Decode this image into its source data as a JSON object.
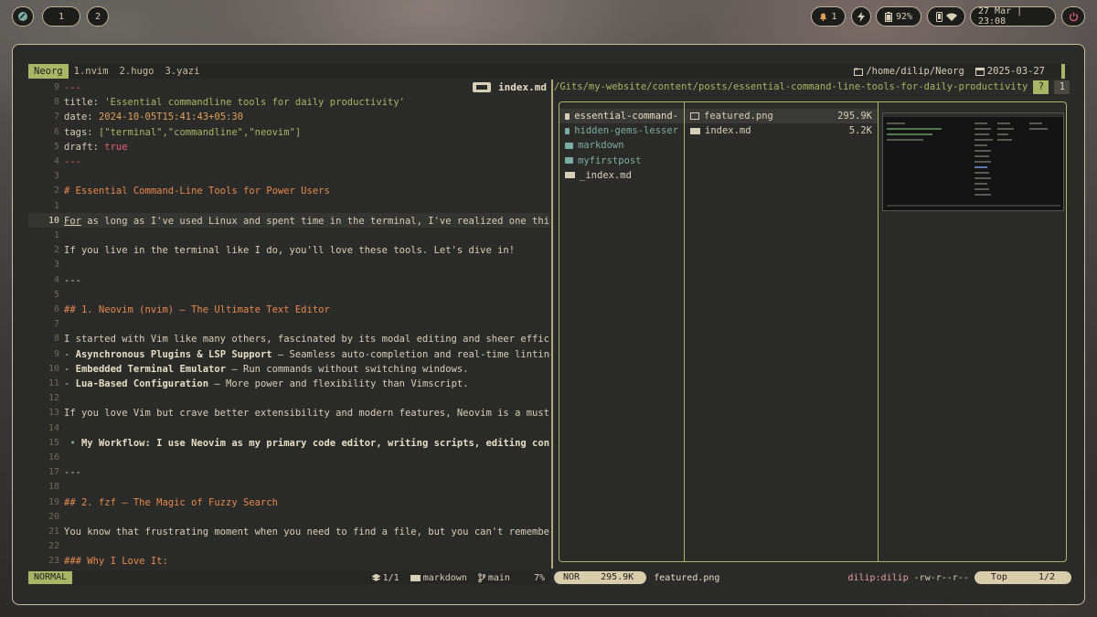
{
  "topbar": {
    "workspaces": [
      "1",
      "2"
    ],
    "notifications": "1",
    "battery": "92%",
    "datetime": "27 Mar | 23:08"
  },
  "tabline": {
    "tabs": [
      "Neorg",
      "1.nvim",
      "2.hugo",
      "3.yazi"
    ],
    "cwd": "/home/dilip/Neorg",
    "date": "2025-03-27"
  },
  "editor": {
    "filename": "index.md",
    "lines": [
      {
        "num": "9",
        "text": "---"
      },
      {
        "num": "8",
        "key": "title",
        "val": "'Essential commandline tools for daily productivity'"
      },
      {
        "num": "7",
        "key": "date",
        "val": "2024-10-05T15:41:43+05:30"
      },
      {
        "num": "6",
        "key": "tags",
        "val": "[\"terminal\",\"commandline\",\"neovim\"]"
      },
      {
        "num": "5",
        "key": "draft",
        "val": "true"
      },
      {
        "num": "4",
        "text": "---"
      },
      {
        "num": "3",
        "text": ""
      },
      {
        "num": "2",
        "text": "# Essential Command-Line Tools for Power Users"
      },
      {
        "num": "1",
        "text": ""
      },
      {
        "num": "10",
        "text": "For as long as I've used Linux and spent time in the terminal, I've realized one thin"
      },
      {
        "num": "1",
        "text": ""
      },
      {
        "num": "2",
        "text": "If you live in the terminal like I do, you'll love these tools. Let's dive in!"
      },
      {
        "num": "3",
        "text": ""
      },
      {
        "num": "4",
        "text": "---"
      },
      {
        "num": "5",
        "text": ""
      },
      {
        "num": "6",
        "text": "## 1. Neovim (nvim) – The Ultimate Text Editor"
      },
      {
        "num": "7",
        "text": ""
      },
      {
        "num": "8",
        "text": "I started with Vim like many others, fascinated by its modal editing and sheer effici"
      },
      {
        "num": "9",
        "bold": "Asynchronous Plugins & LSP Support",
        "rest": " – Seamless auto-completion and real-time linting"
      },
      {
        "num": "10",
        "bold": "Embedded Terminal Emulator",
        "rest": " – Run commands without switching windows."
      },
      {
        "num": "11",
        "bold": "Lua-Based Configuration",
        "rest": " – More power and flexibility than Vimscript."
      },
      {
        "num": "12",
        "text": ""
      },
      {
        "num": "13",
        "text": "If you love Vim but crave better extensibility and modern features, Neovim is a must-"
      },
      {
        "num": "14",
        "text": ""
      },
      {
        "num": "15",
        "bullet": "My Workflow: I use Neovim as my primary code editor, writing scripts, editing conf"
      },
      {
        "num": "16",
        "text": ""
      },
      {
        "num": "17",
        "text": "---"
      },
      {
        "num": "18",
        "text": ""
      },
      {
        "num": "19",
        "text": "## 2. fzf – The Magic of Fuzzy Search"
      },
      {
        "num": "20",
        "text": ""
      },
      {
        "num": "21",
        "text": "You know that frustrating moment when you need to find a file, but you can't remember"
      },
      {
        "num": "22",
        "text": ""
      },
      {
        "num": "23",
        "text": "### Why I Love It:"
      }
    ],
    "status": {
      "mode": "NORMAL",
      "buffers": "1/1",
      "filetype": "markdown",
      "branch": "main",
      "percent": "7%"
    }
  },
  "yazi": {
    "path": "/Gits/my-website/content/posts/essential-command-line-tools-for-daily-productivity",
    "tab_active": "?",
    "tab_other": "1",
    "parent": [
      {
        "name": "essential-command-",
        "type": "dir",
        "selected": true
      },
      {
        "name": "hidden-gems-lesser",
        "type": "dir"
      },
      {
        "name": "markdown",
        "type": "dir"
      },
      {
        "name": "myfirstpost",
        "type": "dir"
      },
      {
        "name": "_index.md",
        "type": "md"
      }
    ],
    "current": [
      {
        "name": "featured.png",
        "size": "295.9K",
        "type": "img",
        "selected": true
      },
      {
        "name": "index.md",
        "size": "5.2K",
        "type": "md"
      }
    ],
    "status": {
      "mode": "NOR",
      "size": "295.9K",
      "file": "featured.png",
      "owner": "dilip:dilip",
      "perms": "-rw-r--r--",
      "pos": "Top",
      "count": "1/2"
    }
  }
}
